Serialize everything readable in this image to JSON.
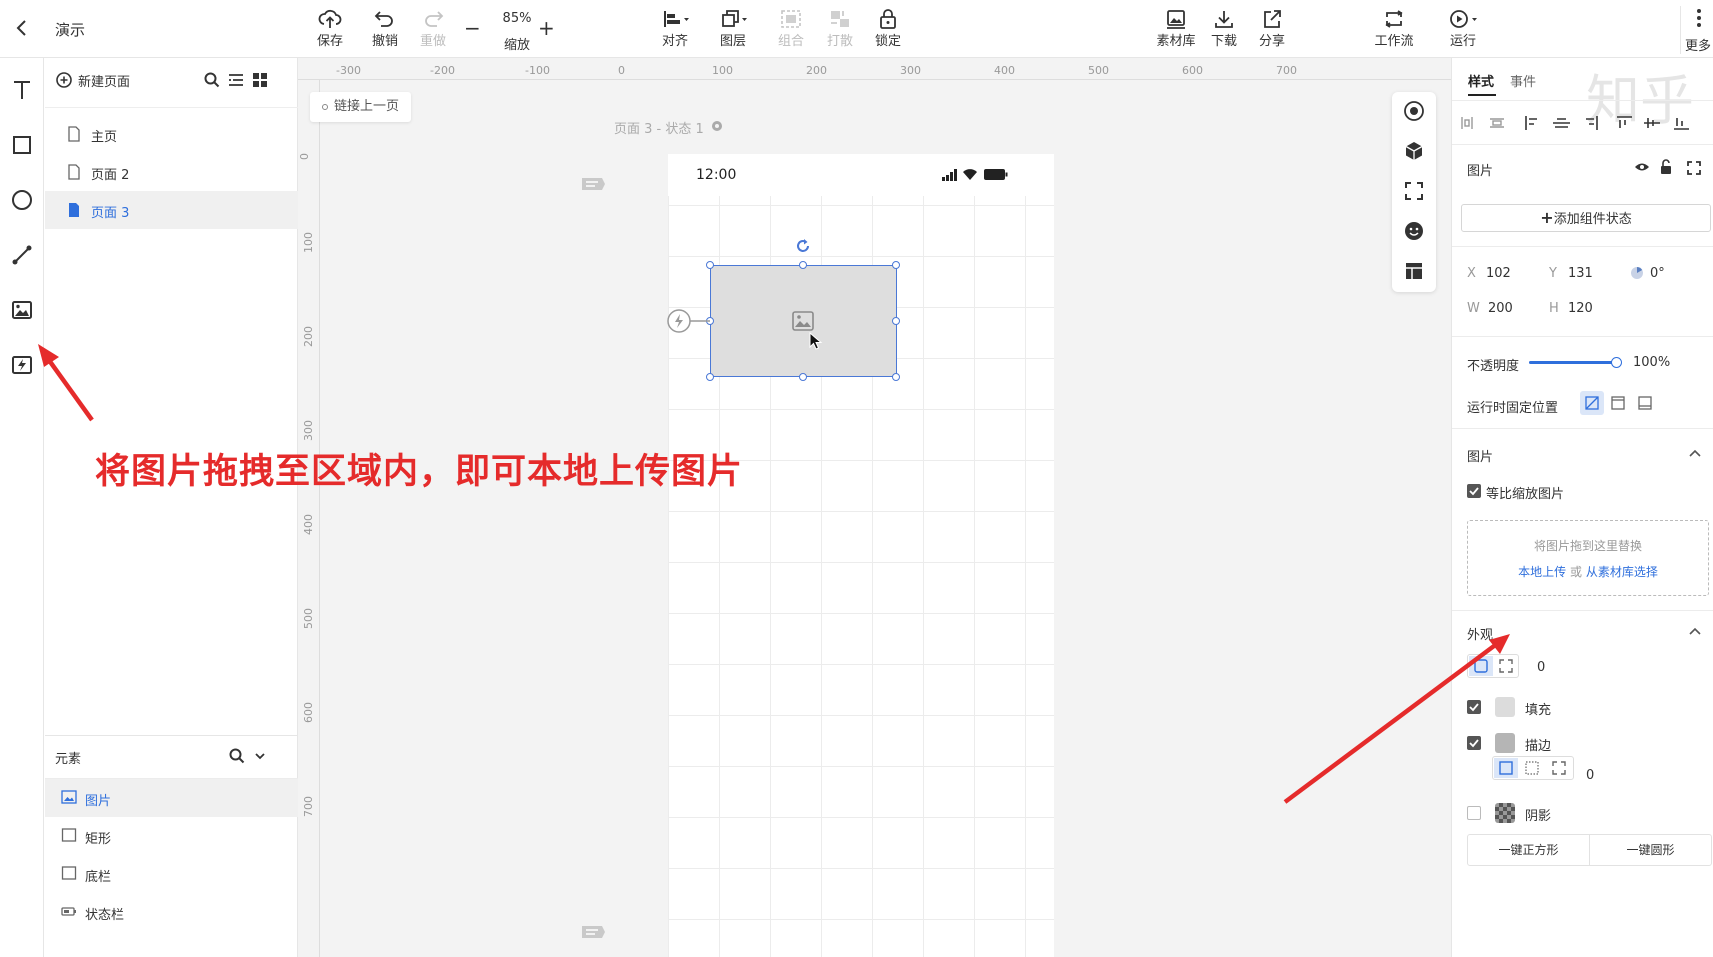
{
  "topbar": {
    "back_icon": "chevron-left-icon",
    "project_name": "演示",
    "save": "保存",
    "undo": "撤销",
    "redo": "重做",
    "zoom_value": "85%",
    "zoom_label": "缩放",
    "align": "对齐",
    "layer": "图层",
    "group": "组合",
    "ungroup": "打散",
    "lock": "锁定",
    "library": "素材库",
    "download": "下载",
    "share": "分享",
    "workflow": "工作流",
    "run": "运行",
    "more": "更多"
  },
  "pages": {
    "new_page": "新建页面",
    "items": [
      {
        "label": "主页",
        "active": false
      },
      {
        "label": "页面 2",
        "active": false
      },
      {
        "label": "页面 3",
        "active": true
      }
    ]
  },
  "elements": {
    "title": "元素",
    "items": [
      {
        "label": "图片",
        "active": true
      },
      {
        "label": "矩形",
        "active": false
      },
      {
        "label": "底栏",
        "active": false
      },
      {
        "label": "状态栏",
        "active": false
      }
    ]
  },
  "canvas": {
    "ruler_h": [
      "-300",
      "-200",
      "-100",
      "0",
      "100",
      "200",
      "300",
      "400",
      "500",
      "600",
      "700"
    ],
    "ruler_v": [
      "0",
      "100",
      "200",
      "300",
      "400",
      "500",
      "600",
      "700"
    ],
    "link_prev": "链接上一页",
    "frame_title": "页面 3 - 状态 1",
    "status_time": "12:00"
  },
  "annotation": "将图片拖拽至区域内，即可本地上传图片",
  "props": {
    "tabs": [
      "样式",
      "事件"
    ],
    "watermark": "知乎",
    "component_title": "图片",
    "add_state": "添加组件状态",
    "x_label": "X",
    "x_value": "102",
    "y_label": "Y",
    "y_value": "131",
    "rotation": "0°",
    "w_label": "W",
    "w_value": "200",
    "h_label": "H",
    "h_value": "120",
    "opacity_label": "不透明度",
    "opacity_value": "100%",
    "opacity": 1.0,
    "fixed_label": "运行时固定位置",
    "image_section": "图片",
    "keep_ratio": "等比缩放图片",
    "drop_hint": "将图片拖到这里替换",
    "local_upload": "本地上传",
    "or_text": "或",
    "from_library": "从素材库选择",
    "appearance": "外观",
    "radius_value": "0",
    "fill_label": "填充",
    "stroke_label": "描边",
    "stroke_value": "0",
    "shadow_label": "阴影",
    "btn_square": "一键正方形",
    "btn_circle": "一键圆形"
  },
  "colors": {
    "accent": "#2f6fdc",
    "annotation": "#e52b2b",
    "selection": "#4a78d6"
  }
}
